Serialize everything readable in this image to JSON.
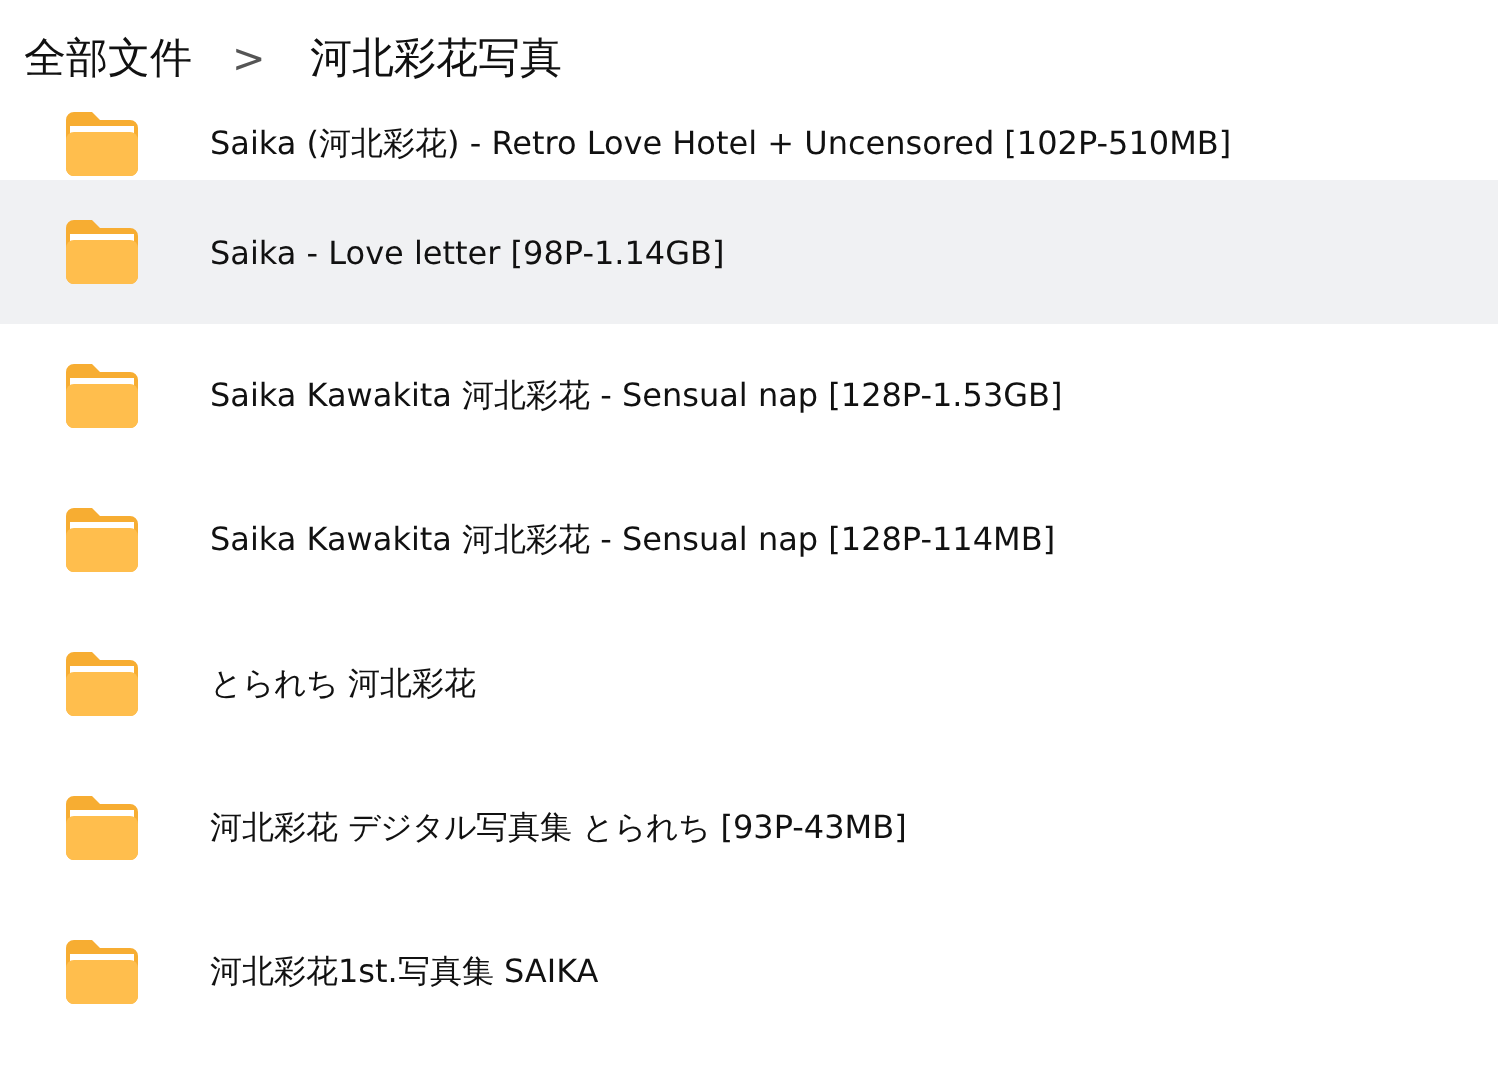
{
  "breadcrumb": [
    {
      "label": "全部文件"
    },
    {
      "label": "河北彩花写真"
    }
  ],
  "separator": ">",
  "files": [
    {
      "name": "Saika (河北彩花) - Retro Love Hotel + Uncensored [102P-510MB]",
      "selected": false
    },
    {
      "name": "Saika - Love letter [98P-1.14GB]",
      "selected": true
    },
    {
      "name": "Saika Kawakita 河北彩花 - Sensual nap [128P-1.53GB]",
      "selected": false
    },
    {
      "name": "Saika Kawakita 河北彩花 - Sensual nap [128P-114MB]",
      "selected": false
    },
    {
      "name": "とられち 河北彩花",
      "selected": false
    },
    {
      "name": "河北彩花 デジタル写真集 とられち [93P-43MB]",
      "selected": false
    },
    {
      "name": "河北彩花1st.写真集 SAIKA",
      "selected": false
    }
  ]
}
